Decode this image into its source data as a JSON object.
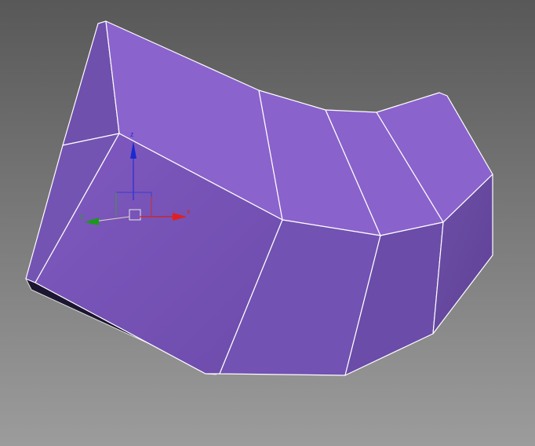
{
  "viewport": {
    "gizmo": {
      "x_label": "x",
      "y_label": "y",
      "z_label": "z"
    },
    "colors": {
      "top_face": "#8b63cd",
      "front_face": "#7b57bb",
      "side_face": "#6a4aa2",
      "x_axis": "#e02020",
      "y_axis": "#1a9a1a",
      "z_axis": "#1a2ad0"
    }
  }
}
